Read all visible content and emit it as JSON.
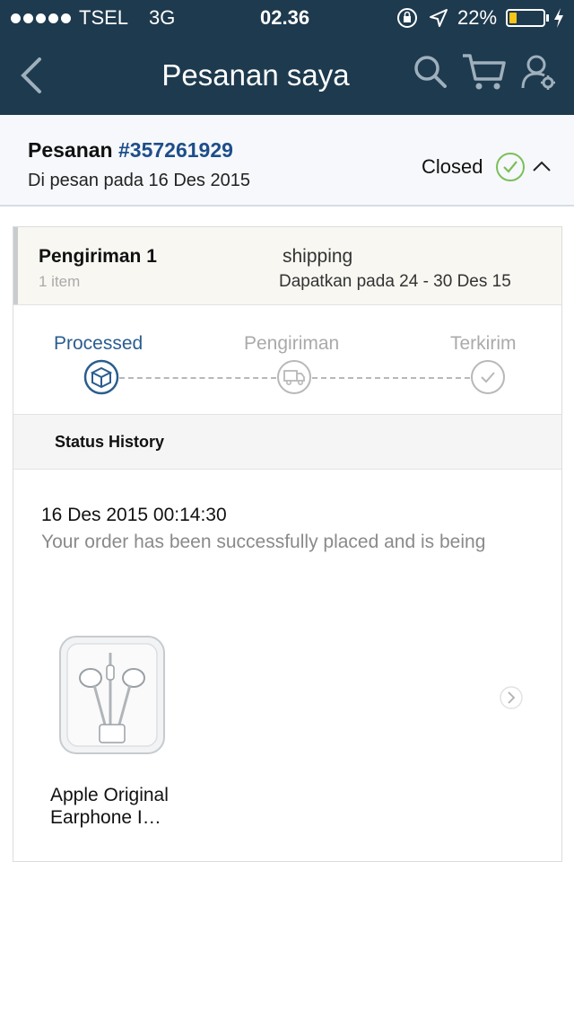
{
  "status_bar": {
    "carrier": "TSEL",
    "network": "3G",
    "time": "02.36",
    "battery_percent": "22%",
    "battery_level": 0.22
  },
  "nav": {
    "title": "Pesanan saya",
    "icons": [
      "back-chevron-icon",
      "search-icon",
      "cart-icon",
      "account-settings-icon"
    ]
  },
  "order": {
    "label": "Pesanan",
    "number": "#357261929",
    "placed_text": "Di pesan pada 16 Des 2015",
    "status": "Closed"
  },
  "shipment": {
    "title": "Pengiriman 1",
    "item_count": "1 item",
    "method": "shipping",
    "delivery": "Dapatkan pada 24 - 30 Des 15"
  },
  "tracker": {
    "steps": [
      {
        "label": "Processed",
        "icon": "box-icon",
        "active": true
      },
      {
        "label": "Pengiriman",
        "icon": "truck-icon",
        "active": false
      },
      {
        "label": "Terkirim",
        "icon": "check-circle-icon",
        "active": false
      }
    ]
  },
  "history": {
    "title": "Status History",
    "entries": [
      {
        "datetime": "16 Des 2015 00:14:30",
        "message": "Your order has been successfully placed and is being"
      }
    ]
  },
  "product": {
    "name": "Apple Original Earphone I…"
  },
  "colors": {
    "nav_bg": "#1e3a4e",
    "accent_blue": "#1d4e8a",
    "active_step": "#2a5d8f",
    "closed_green": "#7bbf5a",
    "battery_yellow": "#f5c518"
  }
}
